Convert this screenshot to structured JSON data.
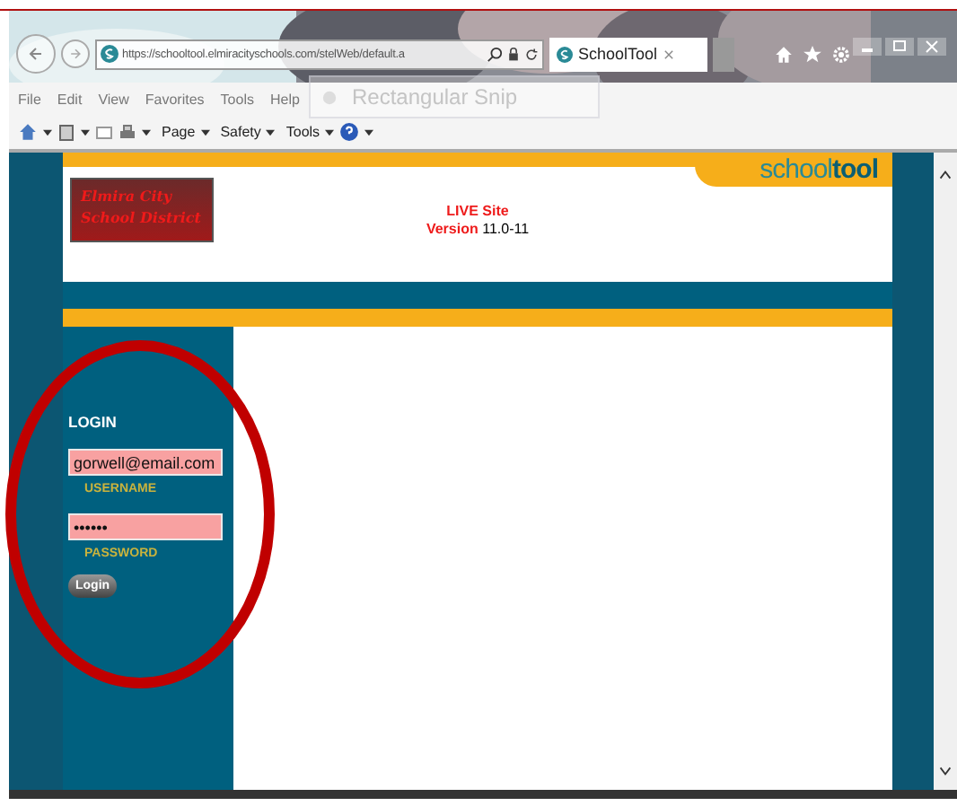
{
  "browser": {
    "address": "https://schooltool.elmiracityschools.com/stelWeb/default.a",
    "tabs": [
      {
        "title": "SchoolTool",
        "selected": true
      }
    ]
  },
  "menu": [
    "File",
    "Edit",
    "View",
    "Favorites",
    "Tools",
    "Help"
  ],
  "commands": [
    "Page",
    "Safety",
    "Tools"
  ],
  "snip_overlay": "Rectangular Snip",
  "page": {
    "logo": "Elmira City School District",
    "brand": "school**tool**",
    "site_status": "LIVE Site",
    "version_label": "Version",
    "version": "11.0-11",
    "login": {
      "heading": "LOGIN",
      "username": {
        "value": "gorwell@email.com",
        "label": "USERNAME"
      },
      "password": {
        "value": "••••••",
        "label": "PASSWORD"
      },
      "button": "Login"
    }
  }
}
